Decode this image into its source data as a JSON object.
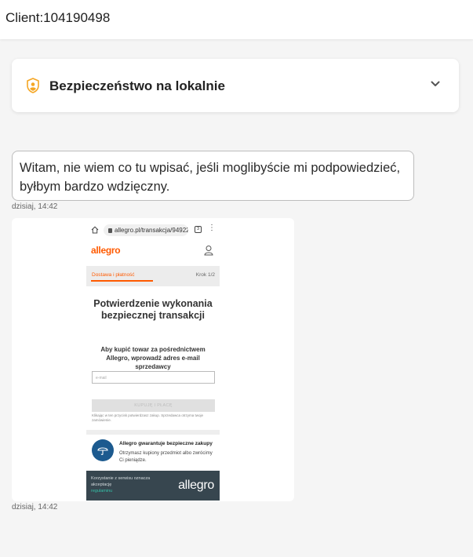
{
  "header": {
    "title": "Client:104190498"
  },
  "accordion": {
    "label": "Bezpieczeństwo na lokalnie",
    "icon": "shield-user-icon",
    "accent": "#f5a623"
  },
  "messages": [
    {
      "lines": [
        "Witam, nie wiem co tu wpisać, jeśli moglibyście mi podpowiedzieć,",
        "byłbym bardzo wdzięczny."
      ],
      "time": "dzisiaj, 14:42"
    },
    {
      "time": "dzisiaj, 14:42"
    }
  ],
  "attachment": {
    "url": "allegro.pl/transakcja/94922",
    "tabs_count": "3",
    "brand": "allegro",
    "step_label": "Dostawa i płatność",
    "step_count": "Krok 1/2",
    "step_progress": 0.5,
    "heading_lines": [
      "Potwierdzenie wykonania",
      "bezpiecznej transakcji"
    ],
    "intro_lines": [
      "Aby kupić towar za pośrednictwem",
      "Allegro, wprowadź adres e-mail",
      "sprzedawcy"
    ],
    "email_placeholder": "e-mail",
    "buy_button": "KUPUJĘ I PŁACĘ",
    "note": "Klikając w ten przycisk potwierdzasz zakup. Sprzedawca otrzyma twoje zamówienie.",
    "guarantee_title": "Allegro gwarantuje bezpieczne zakupy",
    "guarantee_text": "Otrzymasz kupiony przedmiot albo zwrócimy Ci pieniądze.",
    "footer_text": "Korzystanie z serwisu oznacza akceptację",
    "footer_link": "regulaminu",
    "footer_logo": "allegro",
    "brand_color": "#ff5a00"
  }
}
